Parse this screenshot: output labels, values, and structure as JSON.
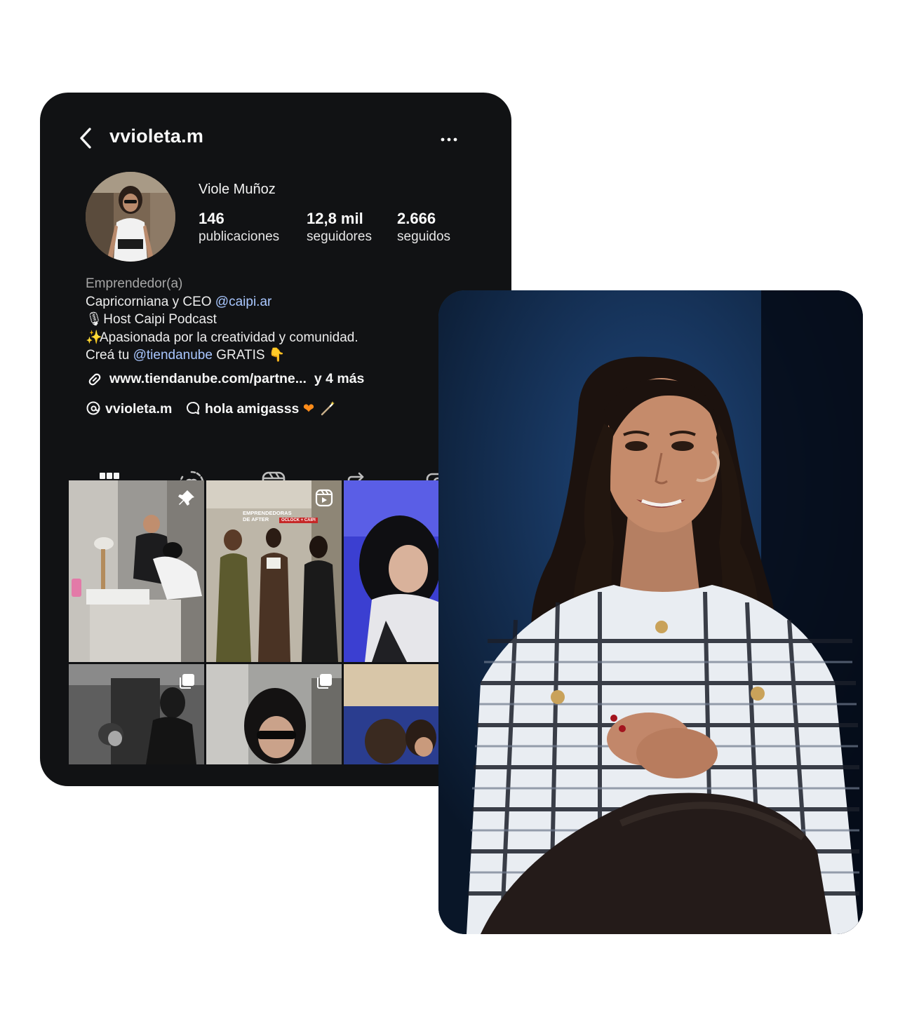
{
  "profile": {
    "username": "vvioleta.m",
    "full_name": "Viole Muñoz",
    "stats": [
      {
        "value": "146",
        "label": "publicaciones"
      },
      {
        "value": "12,8 mil",
        "label": "seguidores"
      },
      {
        "value": "2.666",
        "label": "seguidos"
      }
    ],
    "bio": {
      "category": "Emprendedor(a)",
      "line1_prefix": "Capricorniana y CEO ",
      "line1_mention": "@caipi.ar",
      "line2": "Host Caipi Podcast",
      "line3": "Apasionada por la creatividad y comunidad.",
      "line4_prefix": "Creá tu ",
      "line4_mention": "@tiendanube",
      "line4_suffix": " GRATIS"
    },
    "link": {
      "url": "www.tiendanube.com/partne...",
      "more": "y 4 más"
    },
    "threads_handle": "vvioleta.m",
    "note": "hola amigasss"
  },
  "tabs": [
    {
      "icon": "grid-icon",
      "active": true
    },
    {
      "icon": "highlights-icon",
      "active": false
    },
    {
      "icon": "reels-icon",
      "active": false
    },
    {
      "icon": "reposts-icon",
      "active": false
    },
    {
      "icon": "tagged-icon",
      "active": false
    }
  ],
  "grid_posts": [
    {
      "badge": "pin-icon"
    },
    {
      "badge": "reel-icon",
      "overlay_title": "EMPRENDEDORAS DE AFTER",
      "overlay_tag": "OCLOCK + CAIPI"
    },
    {
      "badge": ""
    },
    {
      "badge": "carousel-icon"
    },
    {
      "badge": "carousel-icon"
    },
    {
      "badge": ""
    }
  ],
  "colors": {
    "phone_bg": "#111214",
    "text": "#f5f5f5",
    "mention": "#a9c7ff",
    "category": "#a6a6a6"
  }
}
